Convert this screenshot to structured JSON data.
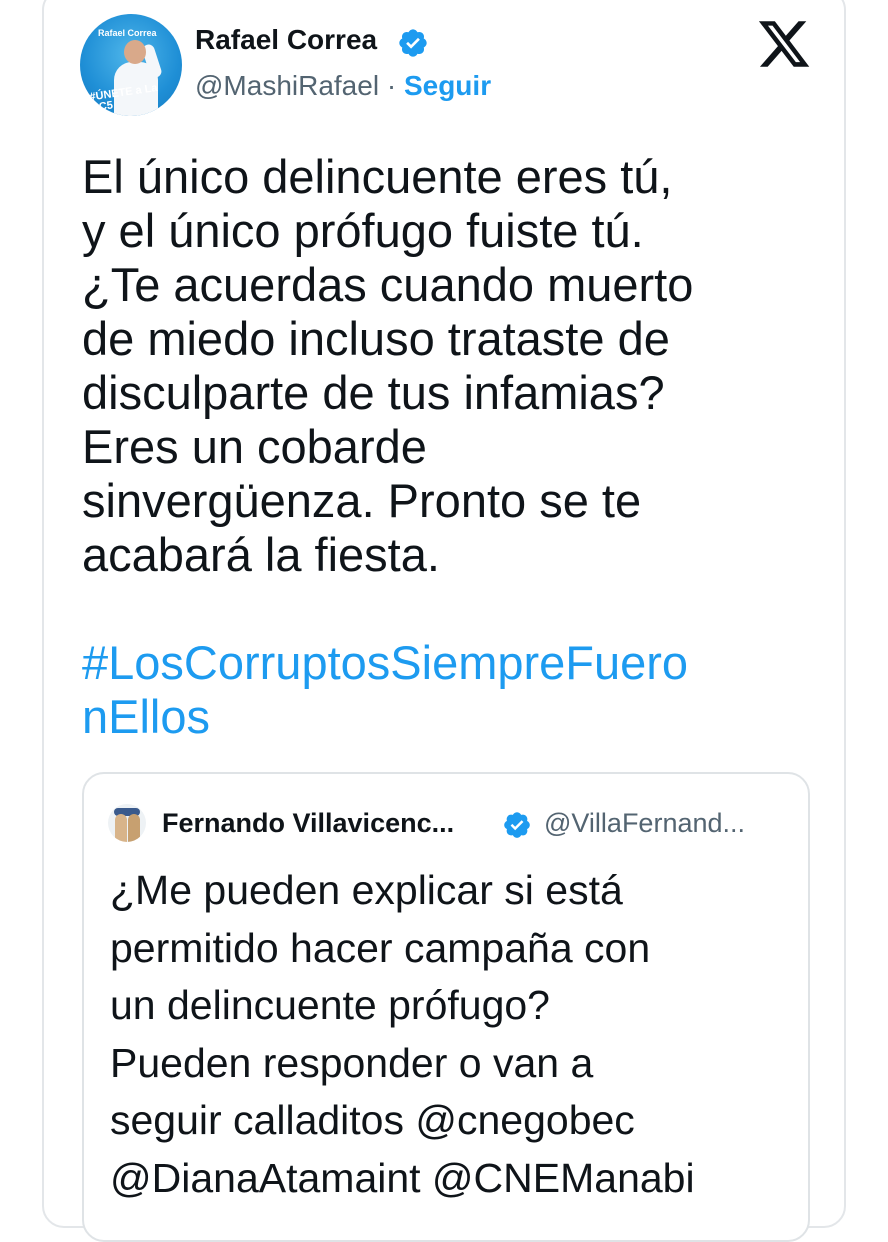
{
  "tweet": {
    "author": {
      "display_name": "Rafael Correa",
      "handle": "@MashiRafael",
      "separator": " · ",
      "follow_label": "Seguir",
      "verified": true,
      "avatar_brand": "Rafael Correa",
      "avatar_tag": "#ÚNETE a La RC5"
    },
    "text": "El único delincuente eres tú,\ny el único prófugo fuiste tú.\n¿Te acuerdas cuando muerto\nde miedo incluso trataste de\ndisculparte de tus infamias?\nEres un cobarde\nsinvergüenza. Pronto se te\nacabará la fiesta.",
    "hashtag": "#LosCorruptosSiempreFuero\nnEllos",
    "platform_icon": "x-logo-icon"
  },
  "quoted_tweet": {
    "author": {
      "display_name": "Fernando Villavicenc...",
      "handle": "@VillaFernand...",
      "verified": true
    },
    "text": "¿Me pueden explicar si está\npermitido hacer campaña con\nun delincuente prófugo?\nPueden responder o van a\nseguir calladitos @cnegobec\n@DianaAtamaint @CNEManabi"
  },
  "colors": {
    "link": "#1d9bf0",
    "verified": "#1d9bf0",
    "text": "#0f1419",
    "muted": "#536471",
    "border": "#e3e6e9"
  }
}
